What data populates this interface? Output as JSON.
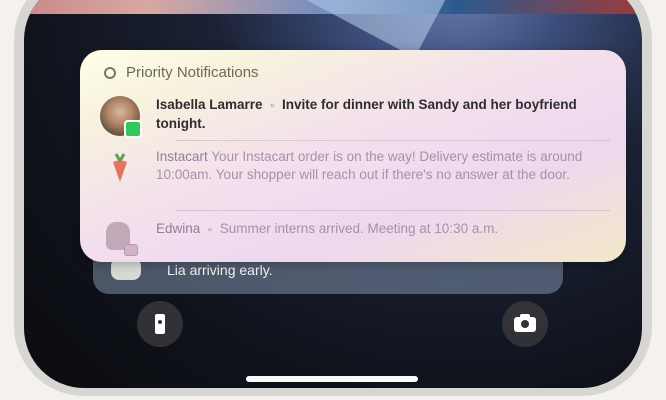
{
  "priority_card": {
    "title": "Priority Notifications",
    "notifications": [
      {
        "sender": "Isabella Lamarre",
        "message": "Invite for dinner with Sandy and her boyfriend tonight.",
        "avatar_icon": "person-photo",
        "badge_icon": "messages-badge"
      },
      {
        "sender": "Instacart",
        "message": "Your Instacart order is on the way! Delivery estimate is around 10:00am. Your shopper will reach out if there's no answer at the door.",
        "avatar_icon": "carrot-icon"
      },
      {
        "sender": "Edwina",
        "message": "Summer interns arrived. Meeting at 10:30 a.m.",
        "avatar_icon": "person-memoji",
        "badge_icon": "messages-badge"
      }
    ]
  },
  "background_notification": {
    "text": "Lia arriving early."
  },
  "lock_screen": {
    "left_button_icon": "flashlight-icon",
    "right_button_icon": "camera-icon"
  },
  "colors": {
    "badge_green": "#34c759",
    "card_yellow": "#fff8d6",
    "card_pink": "#f0d8ee"
  }
}
